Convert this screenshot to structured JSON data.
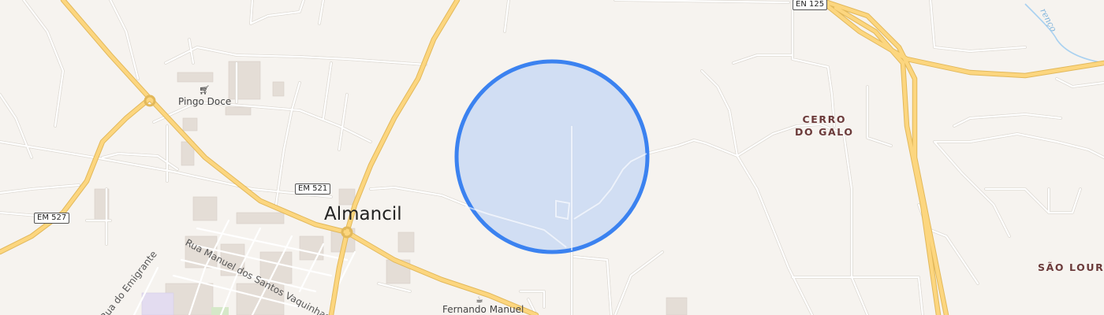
{
  "map": {
    "place_labels": {
      "town": "Almancil",
      "district_1": "CERRO\nDO GALO",
      "district_2": "SÃO LOURE"
    },
    "poi_labels": {
      "supermarket": "Pingo Doce",
      "restaurant": "Fernando Manuel"
    },
    "road_shields": {
      "en125": "EN 125",
      "em521": "EM 521",
      "em527": "EM 527"
    },
    "street_labels": {
      "rua_manuel": "Rua Manuel dos Santos Vaquinhas",
      "rua_emigrante": "Rua do Emigrante"
    },
    "water_labels": {
      "stream": "renço"
    },
    "icons": {
      "supermarket": "shopping-cart-icon",
      "restaurant": "restaurant-icon"
    },
    "colors": {
      "background": "#f6f3ef",
      "main_road": "#fcd67f",
      "minor_road": "#ffffff",
      "accuracy_circle_fill": "#cddcf3",
      "accuracy_circle_stroke": "#3b82f0",
      "district_label": "#6b3a3a",
      "water_label": "#7fb4dc"
    }
  }
}
